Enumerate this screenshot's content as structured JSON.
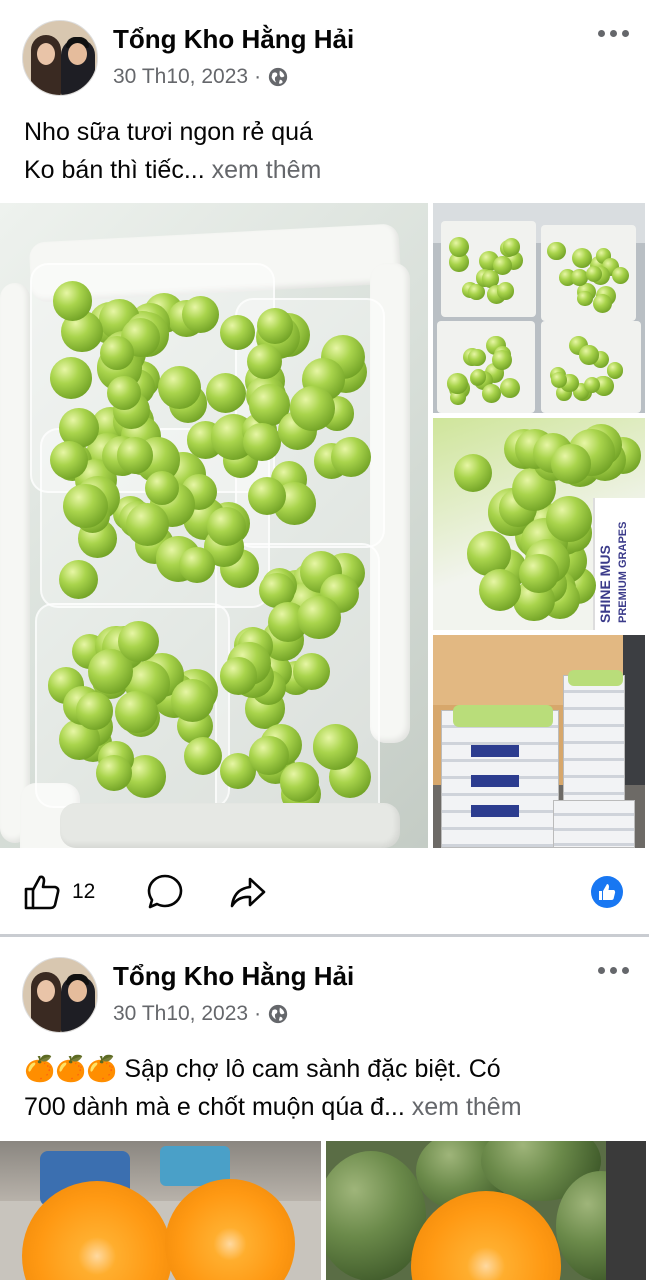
{
  "posts": [
    {
      "author": "Tổng Kho Hằng Hải",
      "date": "30 Th10, 2023",
      "dot": "·",
      "caption_line1": "Nho sữa tươi ngon rẻ quá",
      "caption_line2": "Ko bán thì tiếc...",
      "see_more": "xem thêm",
      "like_count": "12",
      "box_labels": [
        "PREMIUM GRAPES",
        "SHINE MUS"
      ]
    },
    {
      "author": "Tổng Kho Hằng Hải",
      "date": "30 Th10, 2023",
      "dot": "·",
      "caption_emoji": "🍊🍊🍊",
      "caption_line1": "Sập chợ lô cam sành đặc biệt. Có",
      "caption_line2": "700 dành mà e chốt muộn qúa đ...",
      "see_more": "xem thêm"
    }
  ],
  "icons": {
    "globe": "globe-icon",
    "more": "more-options-icon",
    "like": "thumbs-up-icon",
    "comment": "comment-icon",
    "share": "share-icon",
    "reaction": "like-reaction-icon"
  },
  "colors": {
    "primary_text": "#050505",
    "secondary_text": "#65676b",
    "facebook_blue": "#1877f2",
    "divider": "#c9ccd1"
  }
}
